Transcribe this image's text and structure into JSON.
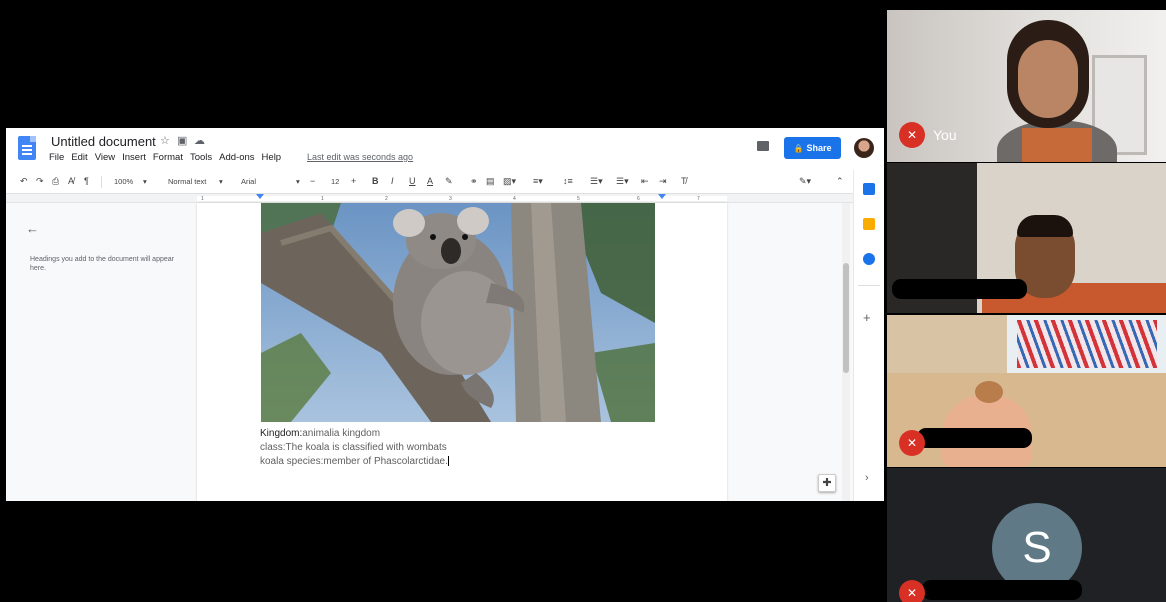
{
  "doc": {
    "title": "Untitled document",
    "menu": [
      "File",
      "Edit",
      "View",
      "Insert",
      "Format",
      "Tools",
      "Add-ons",
      "Help"
    ],
    "last_edit": "Last edit was seconds ago",
    "share_label": "Share",
    "toolbar": {
      "zoom": "100%",
      "style": "Normal text",
      "font": "Arial",
      "font_size": "12"
    },
    "ruler_numbers": [
      "1",
      "1",
      "2",
      "3",
      "4",
      "5",
      "6",
      "7"
    ],
    "outline_hint": "Headings you add to the document will appear here.",
    "lines": [
      {
        "label": "Kingdom:",
        "text": "animalia kingdom"
      },
      {
        "label": "",
        "text": "class:The koala is classified with wombats"
      },
      {
        "label": "",
        "text": "koala species:member of Phascolarctidae."
      }
    ]
  },
  "participants": [
    {
      "name": "You",
      "muted": true
    },
    {
      "name": "",
      "muted": false
    },
    {
      "name": "",
      "muted": true
    },
    {
      "initial": "S",
      "name": "",
      "muted": true
    }
  ],
  "colors": {
    "share_blue": "#1a73e8",
    "mic_off_red": "#d93025",
    "avatar_s": "#5f7986"
  }
}
